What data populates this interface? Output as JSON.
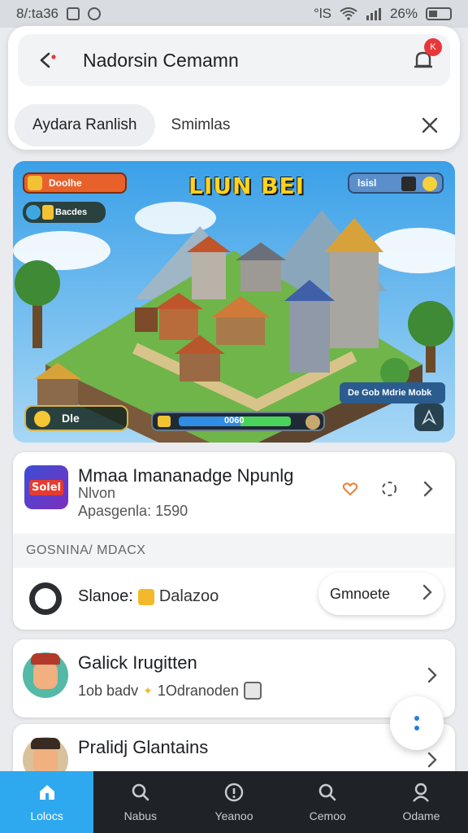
{
  "status_bar": {
    "time": "8/:ta36",
    "signal_text": "°lS",
    "battery": "26%"
  },
  "search": {
    "title": "Nadorsin Cemamn",
    "badge": "K"
  },
  "chips": {
    "active": "Aydara Ranlish",
    "second": "Smimlas"
  },
  "banner": {
    "game_title": "LIUN BEI",
    "hud_top_left": "Doolhe",
    "hud_second": "Bacdes",
    "hud_top_right": "lsisl",
    "hud_bottom_left": "Dle",
    "progress_value": "0060",
    "progress_fraction": 0.92,
    "hud_bottom_right": "De Gob Mdrie Mobk"
  },
  "app": {
    "icon_text": "Solel",
    "name": "Mmaa Imananadge Npunlg",
    "sub": "Nlvon",
    "meta": "Apasgenla: 1590"
  },
  "section": {
    "header": "GOSNINA/ MDACX"
  },
  "friend": {
    "name": "Slanoe:",
    "tag": "Dalazoo",
    "button": "Gmnoete"
  },
  "users": [
    {
      "name": "Galick Irugitten",
      "meta_a": "1ob badv",
      "meta_b": "1Odranoden"
    },
    {
      "name": "Pralidj Glantains"
    }
  ],
  "nav": [
    {
      "label": "Lolocs",
      "icon": "home-icon",
      "active": true
    },
    {
      "label": "Nabus",
      "icon": "search-icon",
      "active": false
    },
    {
      "label": "Yeanoo",
      "icon": "info-icon",
      "active": false
    },
    {
      "label": "Cemoo",
      "icon": "search-icon",
      "active": false
    },
    {
      "label": "Odame",
      "icon": "profile-icon",
      "active": false
    }
  ],
  "colors": {
    "accent": "#2ea8ef",
    "nav_bg": "#1f2226",
    "badge": "#e8373c"
  }
}
